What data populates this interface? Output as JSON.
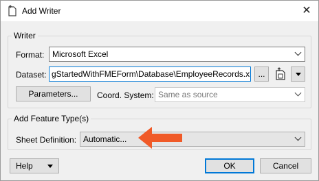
{
  "window": {
    "title": "Add Writer",
    "close_glyph": "✕"
  },
  "writer_group": {
    "legend": "Writer",
    "format_label": "Format:",
    "format_value": "Microsoft Excel",
    "dataset_label": "Dataset:",
    "dataset_value": "gStartedWithFMEForm\\Database\\EmployeeRecords.xlsx",
    "browse_label": "...",
    "parameters_label": "Parameters...",
    "coord_label": "Coord. System:",
    "coord_placeholder": "Same as source"
  },
  "feature_group": {
    "legend": "Add Feature Type(s)",
    "sheet_label": "Sheet Definition:",
    "sheet_value": "Automatic..."
  },
  "footer": {
    "help_label": "Help",
    "ok_label": "OK",
    "cancel_label": "Cancel"
  },
  "colors": {
    "annotation_arrow": "#f05a28",
    "focus_border": "#0078d7"
  },
  "icons": [
    "writer-icon",
    "close-icon",
    "browse-icon",
    "dataset-options-icon",
    "dropdown-icon",
    "annotation-arrow-icon"
  ]
}
